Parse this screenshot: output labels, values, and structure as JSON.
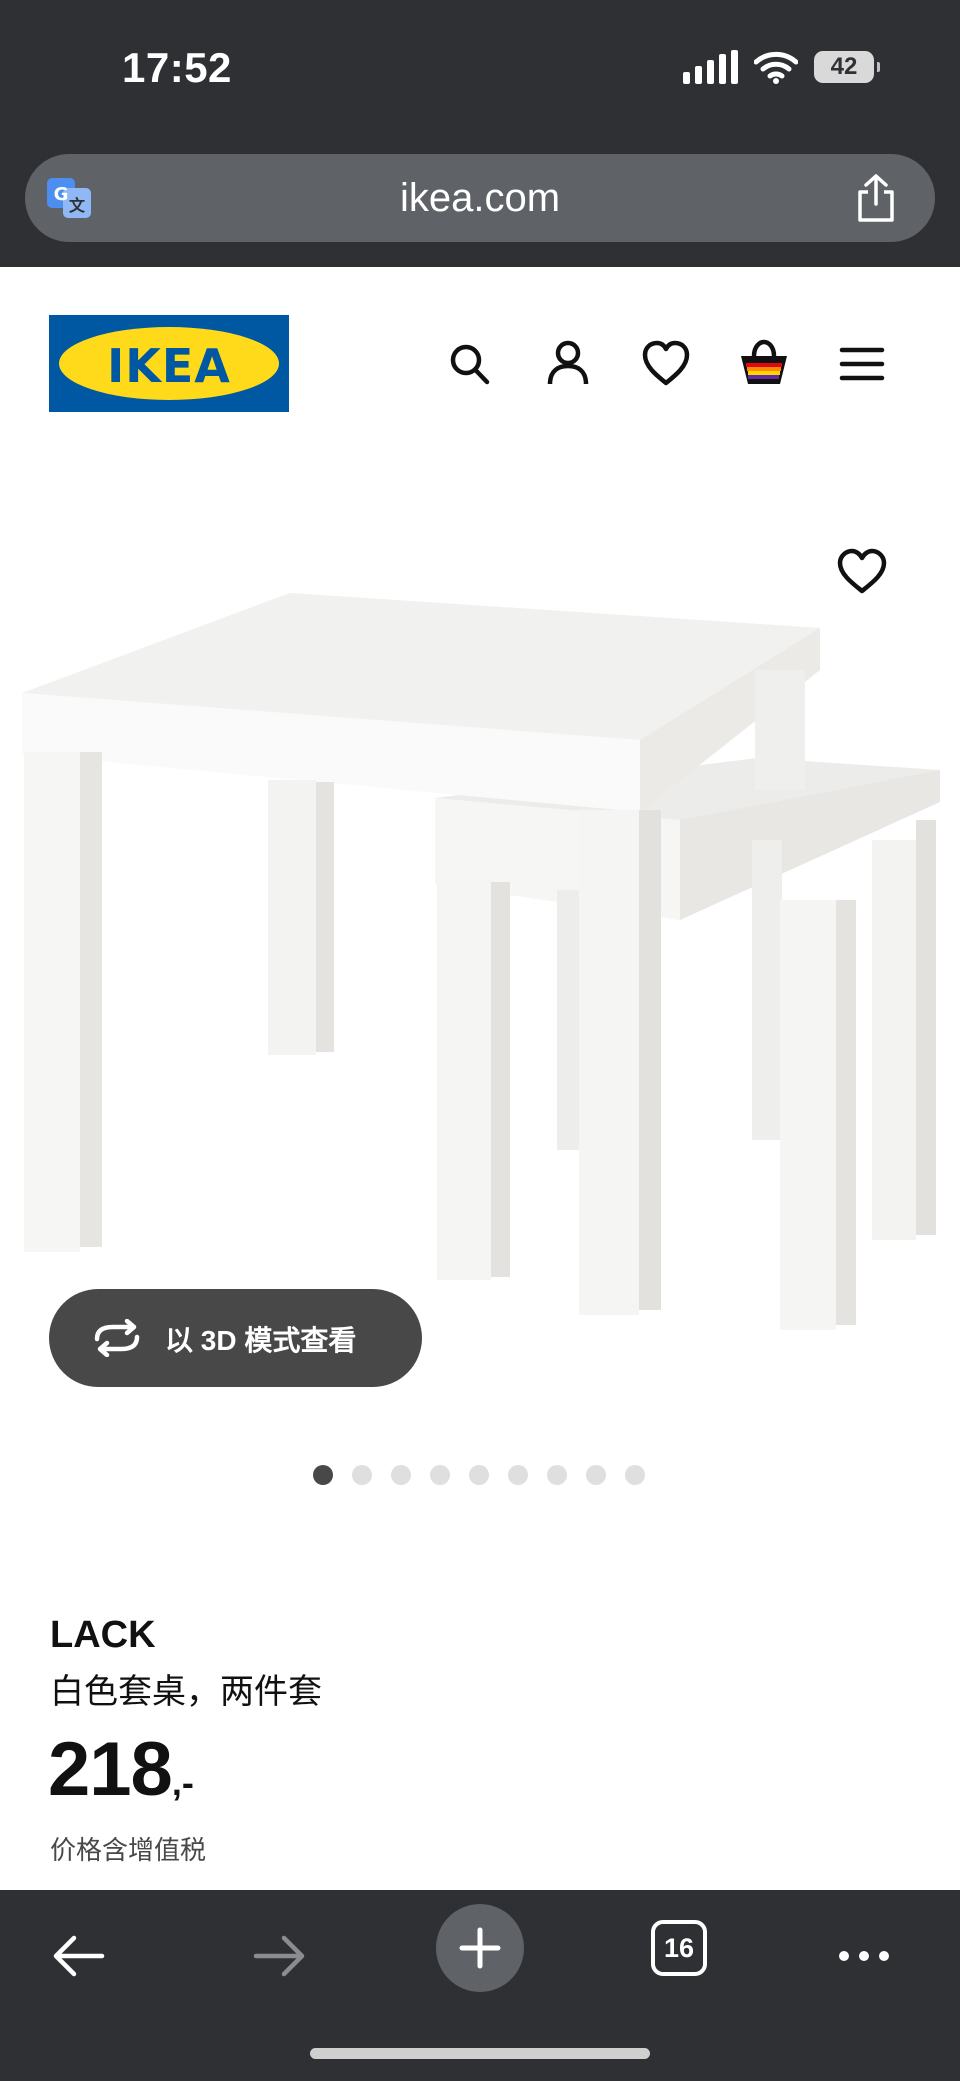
{
  "status_bar": {
    "time": "17:52",
    "battery": "42",
    "icons": [
      "cellular-signal-icon",
      "wifi-icon",
      "battery-icon"
    ]
  },
  "browser": {
    "url": "ikea.com",
    "icons": [
      "translate-icon",
      "share-icon"
    ]
  },
  "header": {
    "logo_text": "IKEA",
    "icons": [
      "search-icon",
      "account-icon",
      "heart-icon",
      "shopping-bag-icon",
      "menu-icon"
    ]
  },
  "gallery": {
    "view_3d_label": "以 3D 模式查看",
    "slide_count": 9,
    "active_slide": 1
  },
  "product": {
    "name": "LACK",
    "description": "白色套桌，两件套",
    "price_integer": "218",
    "price_suffix": ",-",
    "tax_note": "价格含增值税"
  },
  "toolbar": {
    "tab_count": "16",
    "icons": [
      "back-arrow-icon",
      "forward-arrow-icon",
      "plus-icon",
      "tabs-icon",
      "more-icon"
    ]
  },
  "colors": {
    "browser_chrome": "#2e3034",
    "url_field": "#5f6367",
    "ikea_blue": "#0058a3",
    "ikea_yellow": "#ffda1a",
    "pill_button": "#484848"
  }
}
